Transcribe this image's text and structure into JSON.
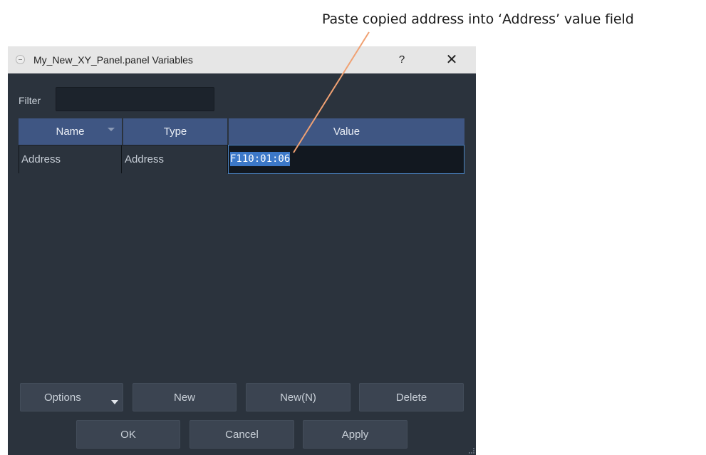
{
  "callout": {
    "text": "Paste copied address into ‘Address’ value field",
    "line_color": "#f0a173"
  },
  "window": {
    "title": "My_New_XY_Panel.panel Variables",
    "help_label": "?",
    "close_label": "✕",
    "app_icon": "panel-app-icon"
  },
  "filter": {
    "label": "Filter",
    "value": "",
    "placeholder": ""
  },
  "table": {
    "columns": [
      "Name",
      "Type",
      "Value"
    ],
    "rows": [
      {
        "name": "Address",
        "type": "Address",
        "value": "F110:01:06"
      }
    ]
  },
  "buttons": {
    "options": "Options",
    "new": "New",
    "new_n": "New(N)",
    "delete": "Delete",
    "ok": "OK",
    "cancel": "Cancel",
    "apply": "Apply"
  },
  "colors": {
    "dialog_bg": "#2b333d",
    "header_bg": "#3f5683",
    "selection": "#3c78c8",
    "focus_border": "#4b84c2"
  }
}
